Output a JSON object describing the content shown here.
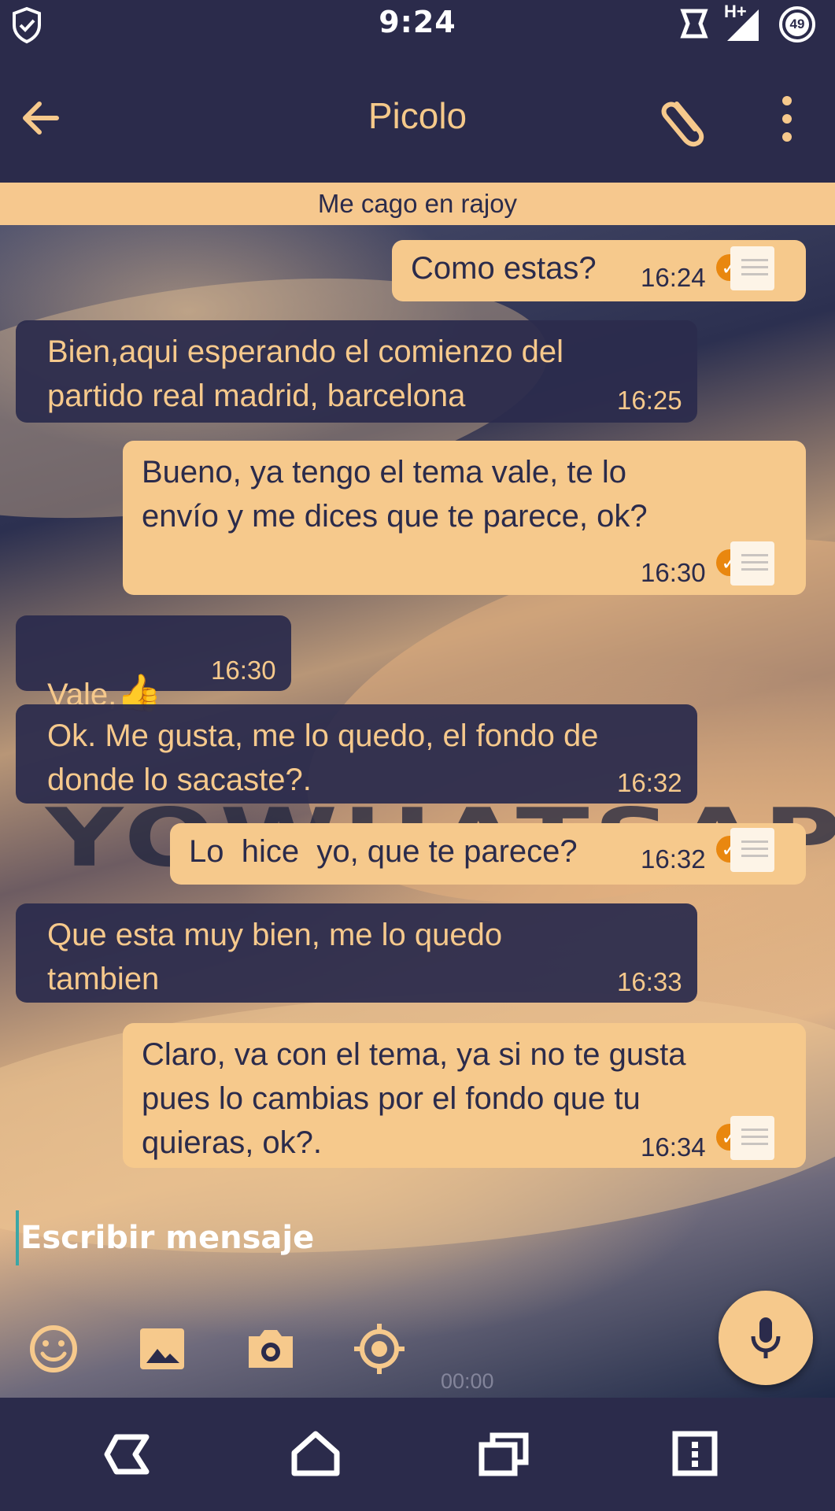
{
  "status_bar": {
    "time": "9:24",
    "network": "H+",
    "battery": "49",
    "icons": [
      "shield-check-icon",
      "sync-icon",
      "signal-icon",
      "battery-icon"
    ]
  },
  "header": {
    "title": "Picolo",
    "subtitle": "Me cago en rajoy",
    "icons": [
      "back-arrow-icon",
      "paperclip-icon",
      "more-vert-icon"
    ]
  },
  "wallpaper": {
    "watermark": "YOWHATSAPP"
  },
  "messages": [
    {
      "dir": "out",
      "text": "Como estas?",
      "time": "16:24"
    },
    {
      "dir": "in",
      "text": "Bien,aqui esperando el comienzo del\npartido real madrid, barcelona",
      "time": "16:25"
    },
    {
      "dir": "out",
      "text": "Bueno, ya tengo el tema vale, te lo\nenvío y me dices que te parece, ok?",
      "time": "16:30"
    },
    {
      "dir": "in",
      "text": "Vale,",
      "emoji": "👍",
      "time": "16:30"
    },
    {
      "dir": "in",
      "text": "Ok. Me gusta, me lo quedo, el fondo de\ndonde lo sacaste?.",
      "time": "16:32"
    },
    {
      "dir": "out",
      "text": "Lo  hice  yo, que te parece?",
      "time": "16:32"
    },
    {
      "dir": "in",
      "text": "Que esta muy bien, me lo quedo\ntambien",
      "time": "16:33"
    },
    {
      "dir": "out",
      "text": "Claro, va con el tema, ya si no te gusta\npues lo cambias por el fondo que tu\nquieras, ok?.",
      "time": "16:34"
    }
  ],
  "composer": {
    "placeholder": "Escribir mensaje",
    "record_time": "00:00",
    "tools": [
      "emoji-icon",
      "gallery-icon",
      "camera-icon",
      "location-icon"
    ],
    "mic": "mic-icon"
  },
  "nav_bar": {
    "buttons": [
      "back-nav-icon",
      "home-icon",
      "recents-icon",
      "menu-icon"
    ]
  },
  "colors": {
    "bar": "#2b2b4b",
    "accent": "#f6c98c",
    "tick": "#e9870f"
  }
}
